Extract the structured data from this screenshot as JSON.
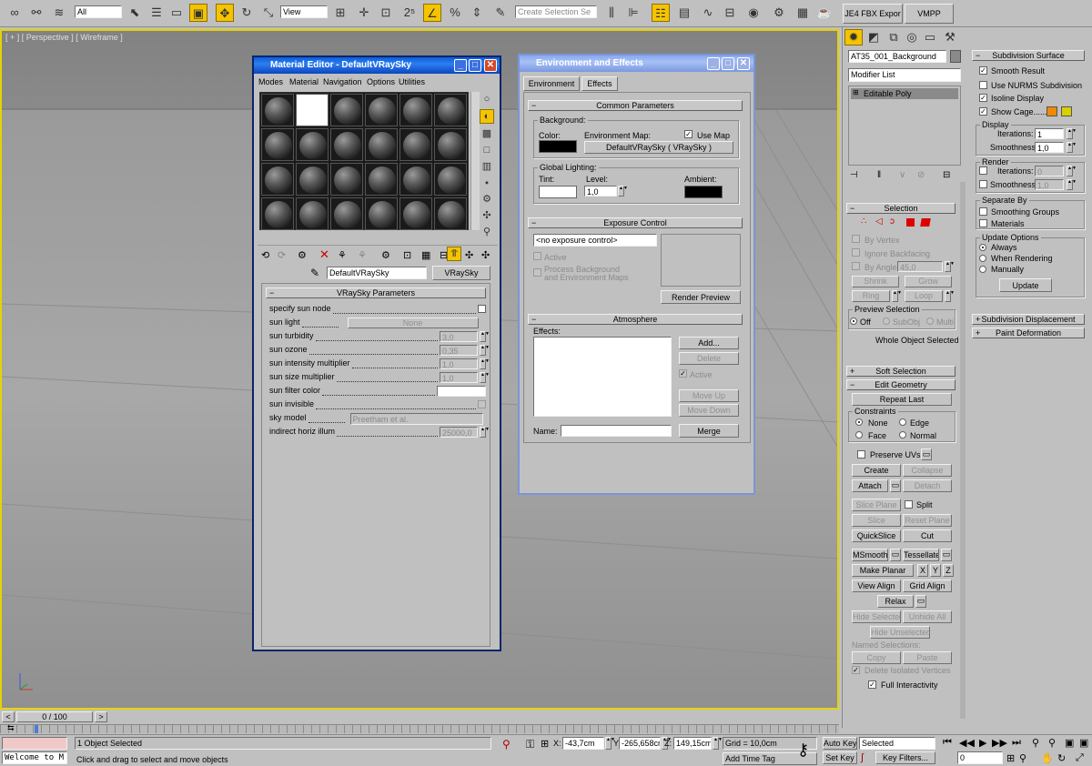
{
  "toolbar": {
    "selection_filter": "All",
    "ref_coord": "View",
    "named_selection_placeholder": "Create Selection Se",
    "tab_fbx": "JE4 FBX Expor",
    "tab_vmpp": "VMPP"
  },
  "viewport": {
    "label": "[ + ] [ Perspective ] [ Wireframe ]"
  },
  "material_editor": {
    "title": "Material Editor - DefaultVRaySky",
    "menus": [
      "Modes",
      "Material",
      "Navigation",
      "Options",
      "Utilities"
    ],
    "material_name": "DefaultVRaySky",
    "material_type": "VRaySky",
    "rollout": "VRaySky Parameters",
    "params": [
      {
        "label": "specify sun node",
        "value": ""
      },
      {
        "label": "sun light",
        "value": "None"
      },
      {
        "label": "sun turbidity",
        "value": "3,0"
      },
      {
        "label": "sun ozone",
        "value": "0,35"
      },
      {
        "label": "sun intensity multiplier",
        "value": "1,0"
      },
      {
        "label": "sun size multiplier",
        "value": "1,0"
      },
      {
        "label": "sun filter color",
        "value": ""
      },
      {
        "label": "sun invisible",
        "value": ""
      },
      {
        "label": "sky model",
        "value": "Preetham et al."
      },
      {
        "label": "indirect horiz illum",
        "value": "25000,0"
      }
    ]
  },
  "env": {
    "title": "Environment and Effects",
    "tabs": [
      "Environment",
      "Effects"
    ],
    "common_params": "Common Parameters",
    "background": "Background:",
    "color": "Color:",
    "env_map": "Environment Map:",
    "use_map": "Use Map",
    "map_button": "DefaultVRaySky  ( VRaySky )",
    "global_lighting": "Global Lighting:",
    "tint": "Tint:",
    "level": "Level:",
    "level_value": "1,0",
    "ambient": "Ambient:",
    "exposure_control": "Exposure Control",
    "exposure_select": "<no exposure control>",
    "active": "Active",
    "process_bg_1": "Process Background",
    "process_bg_2": "and Environment Maps",
    "render_preview": "Render Preview",
    "atmosphere": "Atmosphere",
    "effects": "Effects:",
    "add": "Add...",
    "delete": "Delete",
    "active2": "Active",
    "move_up": "Move Up",
    "move_down": "Move Down",
    "name": "Name:",
    "merge": "Merge"
  },
  "cmd_panel": {
    "object_name": "AT35_001_Background",
    "modifier_list": "Modifier List",
    "stack_item": "Editable Poly",
    "selection": "Selection",
    "by_vertex": "By Vertex",
    "ignore_backfacing": "Ignore Backfacing",
    "by_angle": "By Angle:",
    "angle_value": "45,0",
    "shrink": "Shrink",
    "grow": "Grow",
    "ring": "Ring",
    "loop": "Loop",
    "preview_selection": "Preview Selection",
    "off": "Off",
    "subobj": "SubObj",
    "multi": "Multi",
    "whole_object": "Whole Object Selected",
    "soft_selection": "Soft Selection",
    "edit_geometry": "Edit Geometry",
    "repeat_last": "Repeat Last",
    "constraints": "Constraints",
    "none": "None",
    "edge": "Edge",
    "face": "Face",
    "normal": "Normal",
    "preserve_uvs": "Preserve UVs",
    "create": "Create",
    "collapse": "Collapse",
    "attach": "Attach",
    "detach": "Detach",
    "slice_plane": "Slice Plane",
    "split": "Split",
    "slice": "Slice",
    "reset_plane": "Reset Plane",
    "quickslice": "QuickSlice",
    "cut": "Cut",
    "msmooth": "MSmooth",
    "tessellate": "Tessellate",
    "make_planar": "Make Planar",
    "x": "X",
    "y": "Y",
    "z": "Z",
    "view_align": "View Align",
    "grid_align": "Grid Align",
    "relax": "Relax",
    "hide_selected": "Hide Selected",
    "unhide_all": "Unhide All",
    "hide_unselected": "Hide Unselected",
    "named_selections": "Named Selections:",
    "copy": "Copy",
    "paste": "Paste",
    "delete_isolated": "Delete Isolated Vertices",
    "full_interactivity": "Full Interactivity"
  },
  "subdiv_panel": {
    "title": "Subdivision Surface",
    "smooth_result": "Smooth Result",
    "use_nurms": "Use NURMS Subdivision",
    "isoline": "Isoline Display",
    "show_cage": "Show Cage......",
    "display": "Display",
    "iterations": "Iterations:",
    "iterations_value": "1",
    "smoothness": "Smoothness:",
    "smoothness_value": "1,0",
    "render": "Render",
    "r_iterations_value": "0",
    "r_smoothness_value": "1,0",
    "separate_by": "Separate By",
    "smoothing_groups": "Smoothing Groups",
    "materials": "Materials",
    "update_options": "Update Options",
    "always": "Always",
    "when_rendering": "When Rendering",
    "manually": "Manually",
    "update": "Update",
    "subdiv_displacement": "Subdivision Displacement",
    "paint_deformation": "Paint Deformation"
  },
  "status": {
    "timeline": "0 / 100",
    "selected": "1 Object Selected",
    "prompt": "Click and drag to select and move objects",
    "maxscript": "Welcome to M",
    "x": "-43,7cm",
    "y": "-265,658cr",
    "z": "149,15cm",
    "grid": "Grid = 10,0cm",
    "add_time_tag": "Add Time Tag",
    "auto_key": "Auto Key",
    "set_key": "Set Key",
    "selected_dropdown": "Selected",
    "key_filters": "Key Filters...",
    "frame": "0"
  },
  "colors": {
    "accent": "#f5c400",
    "title_active": "#0a5fd8",
    "title_inactive": "#a8c0f5"
  }
}
